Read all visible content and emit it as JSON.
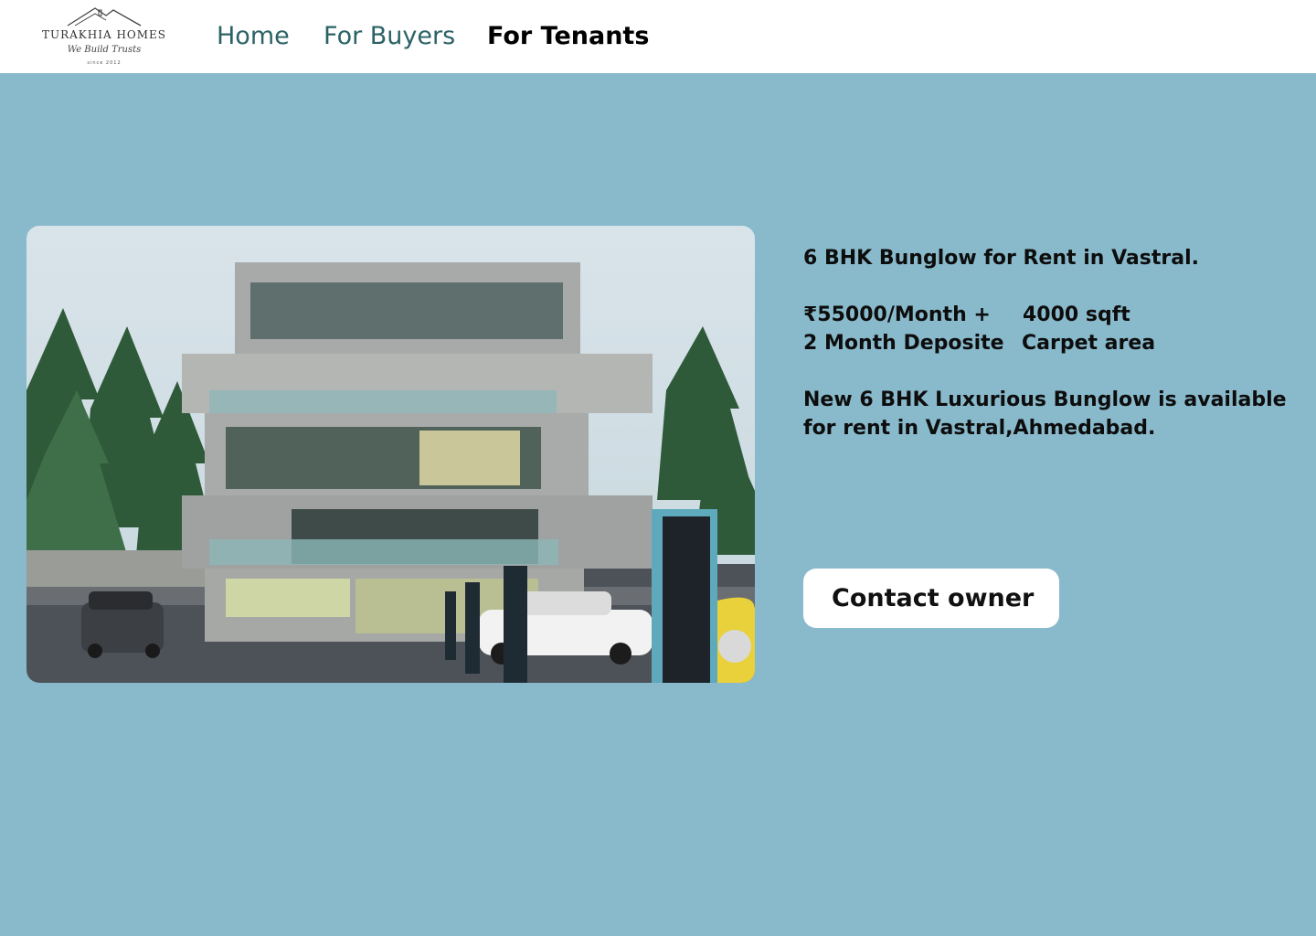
{
  "brand": {
    "name": "TURAKHIA HOMES",
    "tagline": "We Build Trusts",
    "since": "since 2012"
  },
  "nav": {
    "items": [
      {
        "label": "Home"
      },
      {
        "label": "For Buyers"
      },
      {
        "label": "For Tenants",
        "active": true
      }
    ]
  },
  "listing": {
    "image_icon": "bungalow-photo",
    "title": "6 BHK Bunglow for Rent in Vastral.",
    "price_line1": "₹55000/Month +",
    "price_line2": "2 Month Deposite",
    "area_line1": "4000 sqft",
    "area_line2": "Carpet area",
    "description": "New 6 BHK Luxurious Bunglow is available for rent in Vastral,Ahmedabad.",
    "contact_label": "Contact owner"
  },
  "colors": {
    "background": "#89bacc",
    "nav_link": "#2b6266",
    "nav_active": "#000000",
    "button_bg": "#ffffff"
  }
}
